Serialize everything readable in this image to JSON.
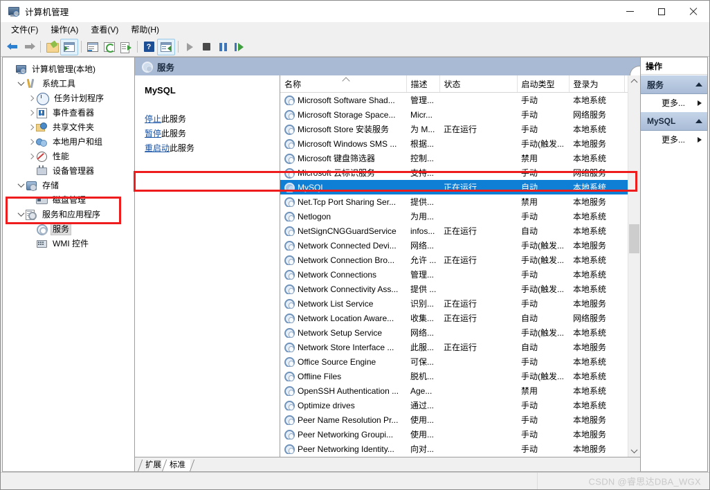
{
  "window": {
    "title": "计算机管理",
    "icon": "computer-management-icon",
    "buttons": {
      "minimize": "—",
      "maximize": "□",
      "close": "✕"
    }
  },
  "menubar": [
    {
      "label": "文件(F)",
      "text": "文件",
      "key": "F"
    },
    {
      "label": "操作(A)",
      "text": "操作",
      "key": "A"
    },
    {
      "label": "查看(V)",
      "text": "查看",
      "key": "V"
    },
    {
      "label": "帮助(H)",
      "text": "帮助",
      "key": "H"
    }
  ],
  "toolbar": [
    {
      "name": "back-icon"
    },
    {
      "name": "forward-icon"
    },
    {
      "name": "up-folder-icon"
    },
    {
      "name": "show-hide-console-tree-icon"
    },
    {
      "name": "properties-icon"
    },
    {
      "name": "refresh-icon"
    },
    {
      "name": "export-list-icon"
    },
    {
      "name": "help-icon"
    },
    {
      "name": "show-hide-action-pane-icon"
    },
    {
      "name": "start-service-icon"
    },
    {
      "name": "stop-service-icon"
    },
    {
      "name": "pause-service-icon"
    },
    {
      "name": "restart-service-icon"
    }
  ],
  "tree": [
    {
      "label": "计算机管理(本地)",
      "indent": 0,
      "expander": "none",
      "icon": "computer-icon",
      "selected": false
    },
    {
      "label": "系统工具",
      "indent": 1,
      "expander": "down",
      "icon": "tools-icon",
      "selected": false
    },
    {
      "label": "任务计划程序",
      "indent": 2,
      "expander": "right",
      "icon": "clock-icon",
      "selected": false
    },
    {
      "label": "事件查看器",
      "indent": 2,
      "expander": "right",
      "icon": "event-viewer-icon",
      "selected": false
    },
    {
      "label": "共享文件夹",
      "indent": 2,
      "expander": "right",
      "icon": "shared-folder-icon",
      "selected": false
    },
    {
      "label": "本地用户和组",
      "indent": 2,
      "expander": "right",
      "icon": "users-groups-icon",
      "selected": false
    },
    {
      "label": "性能",
      "indent": 2,
      "expander": "right",
      "icon": "performance-icon",
      "selected": false
    },
    {
      "label": "设备管理器",
      "indent": 2,
      "expander": "none",
      "icon": "device-manager-icon",
      "selected": false
    },
    {
      "label": "存储",
      "indent": 1,
      "expander": "down",
      "icon": "storage-icon",
      "selected": false
    },
    {
      "label": "磁盘管理",
      "indent": 2,
      "expander": "none",
      "icon": "disk-management-icon",
      "selected": false
    },
    {
      "label": "服务和应用程序",
      "indent": 1,
      "expander": "down",
      "icon": "services-apps-icon",
      "selected": false
    },
    {
      "label": "服务",
      "indent": 2,
      "expander": "none",
      "icon": "services-gear-icon",
      "selected": true
    },
    {
      "label": "WMI 控件",
      "indent": 2,
      "expander": "none",
      "icon": "wmi-control-icon",
      "selected": false
    }
  ],
  "center": {
    "header": {
      "title": "服务",
      "icon": "services-gear-icon"
    },
    "detail": {
      "service_name": "MySQL",
      "links": [
        {
          "link_text": "停止",
          "rest": "此服务"
        },
        {
          "link_text": "暂停",
          "rest": "此服务"
        },
        {
          "link_text": "重启动",
          "rest": "此服务"
        }
      ]
    },
    "columns": [
      {
        "label": "名称",
        "sorted": "asc"
      },
      {
        "label": "描述",
        "sorted": ""
      },
      {
        "label": "状态",
        "sorted": ""
      },
      {
        "label": "启动类型",
        "sorted": ""
      },
      {
        "label": "登录为",
        "sorted": ""
      }
    ],
    "rows": [
      {
        "name": "Microsoft Software Shad...",
        "desc": "管理...",
        "status": "",
        "startup": "手动",
        "logon": "本地系统",
        "selected": false
      },
      {
        "name": "Microsoft Storage Space...",
        "desc": "Micr...",
        "status": "",
        "startup": "手动",
        "logon": "网络服务",
        "selected": false
      },
      {
        "name": "Microsoft Store 安装服务",
        "desc": "为 M...",
        "status": "正在运行",
        "startup": "手动",
        "logon": "本地系统",
        "selected": false
      },
      {
        "name": "Microsoft Windows SMS ...",
        "desc": "根据...",
        "status": "",
        "startup": "手动(触发...",
        "logon": "本地服务",
        "selected": false
      },
      {
        "name": "Microsoft 键盘筛选器",
        "desc": "控制...",
        "status": "",
        "startup": "禁用",
        "logon": "本地系统",
        "selected": false
      },
      {
        "name": "Microsoft 云标识服务",
        "desc": "支持...",
        "status": "",
        "startup": "手动",
        "logon": "网络服务",
        "selected": false
      },
      {
        "name": "MySQL",
        "desc": "",
        "status": "正在运行",
        "startup": "自动",
        "logon": "本地系统",
        "selected": true
      },
      {
        "name": "Net.Tcp Port Sharing Ser...",
        "desc": "提供...",
        "status": "",
        "startup": "禁用",
        "logon": "本地服务",
        "selected": false
      },
      {
        "name": "Netlogon",
        "desc": "为用...",
        "status": "",
        "startup": "手动",
        "logon": "本地系统",
        "selected": false
      },
      {
        "name": "NetSignCNGGuardService",
        "desc": "infos...",
        "status": "正在运行",
        "startup": "自动",
        "logon": "本地系统",
        "selected": false
      },
      {
        "name": "Network Connected Devi...",
        "desc": "网络...",
        "status": "",
        "startup": "手动(触发...",
        "logon": "本地服务",
        "selected": false
      },
      {
        "name": "Network Connection Bro...",
        "desc": "允许 ...",
        "status": "正在运行",
        "startup": "手动(触发...",
        "logon": "本地系统",
        "selected": false
      },
      {
        "name": "Network Connections",
        "desc": "管理...",
        "status": "",
        "startup": "手动",
        "logon": "本地系统",
        "selected": false
      },
      {
        "name": "Network Connectivity Ass...",
        "desc": "提供 ...",
        "status": "",
        "startup": "手动(触发...",
        "logon": "本地系统",
        "selected": false
      },
      {
        "name": "Network List Service",
        "desc": "识别...",
        "status": "正在运行",
        "startup": "手动",
        "logon": "本地服务",
        "selected": false
      },
      {
        "name": "Network Location Aware...",
        "desc": "收集...",
        "status": "正在运行",
        "startup": "自动",
        "logon": "网络服务",
        "selected": false
      },
      {
        "name": "Network Setup Service",
        "desc": "网络...",
        "status": "",
        "startup": "手动(触发...",
        "logon": "本地系统",
        "selected": false
      },
      {
        "name": "Network Store Interface ...",
        "desc": "此服...",
        "status": "正在运行",
        "startup": "自动",
        "logon": "本地服务",
        "selected": false
      },
      {
        "name": "Office Source Engine",
        "desc": "可保...",
        "status": "",
        "startup": "手动",
        "logon": "本地系统",
        "selected": false
      },
      {
        "name": "Offline Files",
        "desc": "脱机...",
        "status": "",
        "startup": "手动(触发...",
        "logon": "本地系统",
        "selected": false
      },
      {
        "name": "OpenSSH Authentication ...",
        "desc": "Age...",
        "status": "",
        "startup": "禁用",
        "logon": "本地系统",
        "selected": false
      },
      {
        "name": "Optimize drives",
        "desc": "通过...",
        "status": "",
        "startup": "手动",
        "logon": "本地系统",
        "selected": false
      },
      {
        "name": "Peer Name Resolution Pr...",
        "desc": "使用...",
        "status": "",
        "startup": "手动",
        "logon": "本地服务",
        "selected": false
      },
      {
        "name": "Peer Networking Groupi...",
        "desc": "使用...",
        "status": "",
        "startup": "手动",
        "logon": "本地服务",
        "selected": false
      },
      {
        "name": "Peer Networking Identity...",
        "desc": "向对...",
        "status": "",
        "startup": "手动",
        "logon": "本地服务",
        "selected": false
      }
    ],
    "tabs": [
      {
        "label": "扩展",
        "active": false
      },
      {
        "label": "标准",
        "active": true
      }
    ]
  },
  "actions": {
    "title": "操作",
    "groups": [
      {
        "title": "服务",
        "items": [
          {
            "label": "更多..."
          }
        ]
      },
      {
        "title": "MySQL",
        "items": [
          {
            "label": "更多..."
          }
        ]
      }
    ]
  },
  "watermark": "CSDN @睿思达DBA_WGX",
  "colors": {
    "selection_blue": "#0f7fd6",
    "annotation_red": "#ee1c1c",
    "header_blue_gray": "#a9bbd4",
    "link_blue": "#1552a5"
  }
}
